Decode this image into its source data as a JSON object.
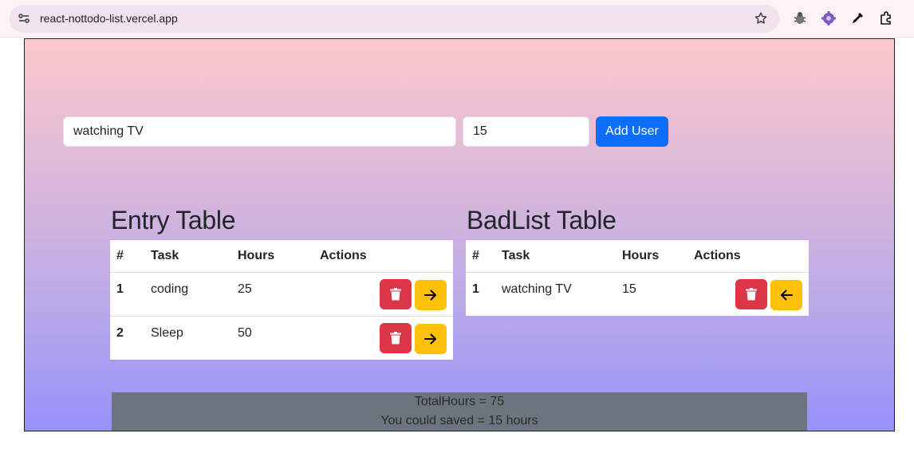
{
  "browser": {
    "url": "react-nottodo-list.vercel.app"
  },
  "form": {
    "task_value": "watching TV",
    "hours_value": "15",
    "add_label": "Add User"
  },
  "entry": {
    "title": "Entry Table",
    "headers": [
      "#",
      "Task",
      "Hours",
      "Actions"
    ],
    "rows": [
      {
        "num": "1",
        "task": "coding",
        "hours": "25"
      },
      {
        "num": "2",
        "task": "Sleep",
        "hours": "50"
      }
    ]
  },
  "bad": {
    "title": "BadList Table",
    "headers": [
      "#",
      "Task",
      "Hours",
      "Actions"
    ],
    "rows": [
      {
        "num": "1",
        "task": "watching TV",
        "hours": "15"
      }
    ]
  },
  "totals": {
    "total_text": "TotalHours = 75",
    "saved_text": "You could saved = 15 hours"
  },
  "colors": {
    "primary": "#0d6efd",
    "danger": "#dc3545",
    "warning": "#ffc107",
    "secondary": "#6c757d"
  },
  "icons": {
    "delete": "trash-icon",
    "move_right": "arrow-right-icon",
    "move_left": "arrow-left-icon"
  }
}
